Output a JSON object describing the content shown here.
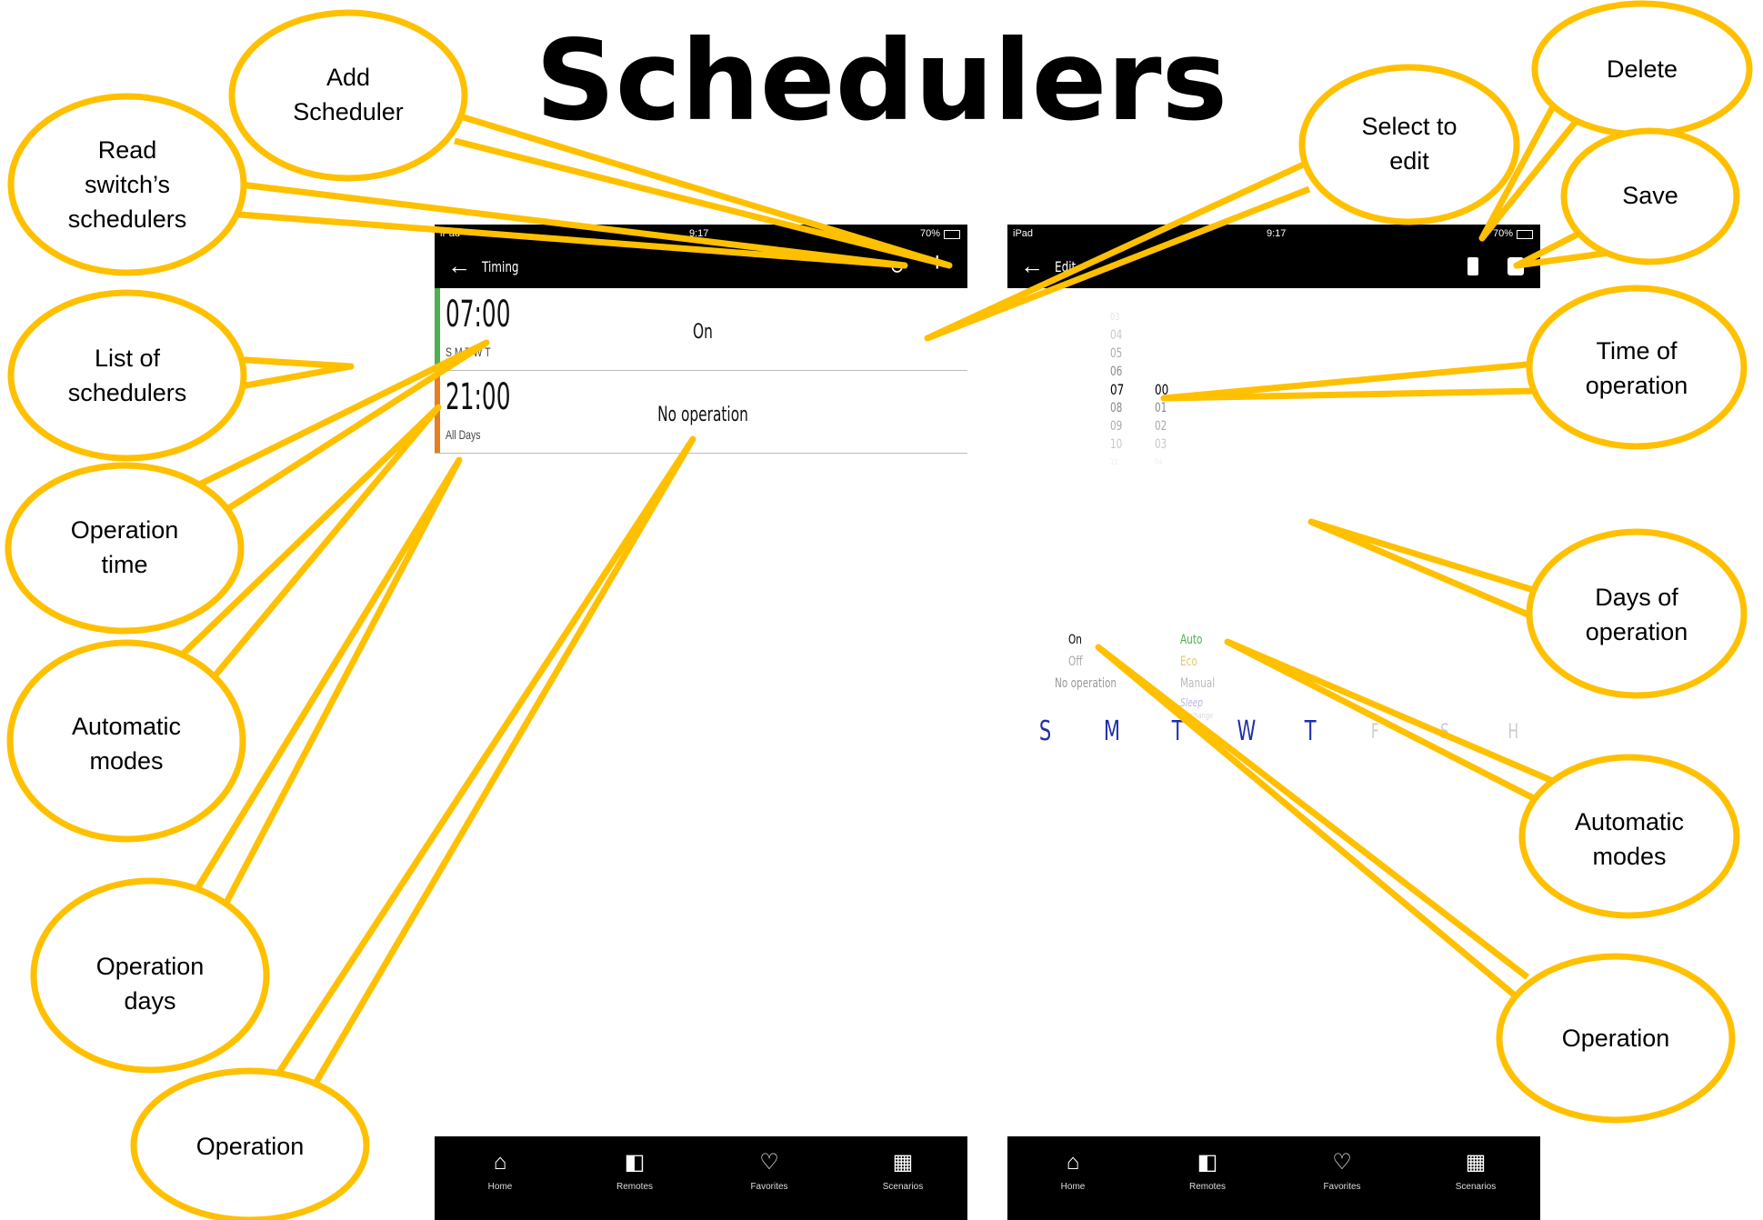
{
  "title": "Schedulers",
  "accent_color": "#ffc000",
  "list_screen": {
    "status": {
      "left": "iPad",
      "time": "9:17",
      "battery": "70%"
    },
    "nav": {
      "back_icon": "arrow-left-icon",
      "title": "Timing",
      "refresh_icon": "refresh-icon",
      "add_icon": "plus-icon"
    },
    "schedulers": [
      {
        "time": "07:00",
        "days": "S M T W T",
        "operation": "On",
        "color": "#4caf50"
      },
      {
        "time": "21:00",
        "days": "All Days",
        "operation": "No operation",
        "color": "#e67e22"
      }
    ]
  },
  "edit_screen": {
    "status": {
      "left": "iPad",
      "time": "9:17",
      "battery": "70%"
    },
    "nav": {
      "back_icon": "arrow-left-icon",
      "title": "Edit",
      "delete_icon": "trash-icon",
      "save_icon": "floppy-icon"
    },
    "hours": [
      "03",
      "04",
      "05",
      "06",
      "07",
      "08",
      "09",
      "10",
      "11"
    ],
    "selected_hour": "07",
    "minutes": [
      "00",
      "01",
      "02",
      "03",
      "04"
    ],
    "selected_minute": "00",
    "days": [
      {
        "label": "S",
        "active": true
      },
      {
        "label": "M",
        "active": true
      },
      {
        "label": "T",
        "active": true
      },
      {
        "label": "W",
        "active": true
      },
      {
        "label": "T",
        "active": true
      },
      {
        "label": "F",
        "active": false
      },
      {
        "label": "S",
        "active": false
      },
      {
        "label": "H",
        "active": false
      }
    ],
    "operations": [
      "On",
      "Off",
      "No operation"
    ],
    "selected_operation": "On",
    "modes": [
      {
        "label": "Auto",
        "color": "#4caf50"
      },
      {
        "label": "Eco",
        "color": "#e6c86e"
      },
      {
        "label": "Manual",
        "color": "#bbbbbb"
      },
      {
        "label": "Sleep",
        "color": "#b8b8e8"
      },
      {
        "label": "No change",
        "color": "#cccccc"
      }
    ]
  },
  "tabbar": [
    {
      "label": "Home",
      "icon": "home-icon"
    },
    {
      "label": "Remotes",
      "icon": "remote-icon"
    },
    {
      "label": "Favorites",
      "icon": "heart-icon"
    },
    {
      "label": "Scenarios",
      "icon": "clapperboard-icon"
    }
  ],
  "callouts": {
    "add_scheduler": [
      "Add",
      "Scheduler"
    ],
    "read_schedulers": [
      "Read",
      "switch’s",
      "schedulers"
    ],
    "list_of_schedulers": [
      "List of",
      "schedulers"
    ],
    "operation_time": [
      "Operation",
      "time"
    ],
    "automatic_modes_left": [
      "Automatic",
      "modes"
    ],
    "operation_days": [
      "Operation",
      "days"
    ],
    "operation_left": [
      "Operation"
    ],
    "select_to_edit": [
      "Select to",
      "edit"
    ],
    "delete": [
      "Delete"
    ],
    "save": [
      "Save"
    ],
    "time_of_operation": [
      "Time of",
      "operation"
    ],
    "days_of_operation": [
      "Days of",
      "operation"
    ],
    "automatic_modes_right": [
      "Automatic",
      "modes"
    ],
    "operation_right": [
      "Operation"
    ]
  }
}
